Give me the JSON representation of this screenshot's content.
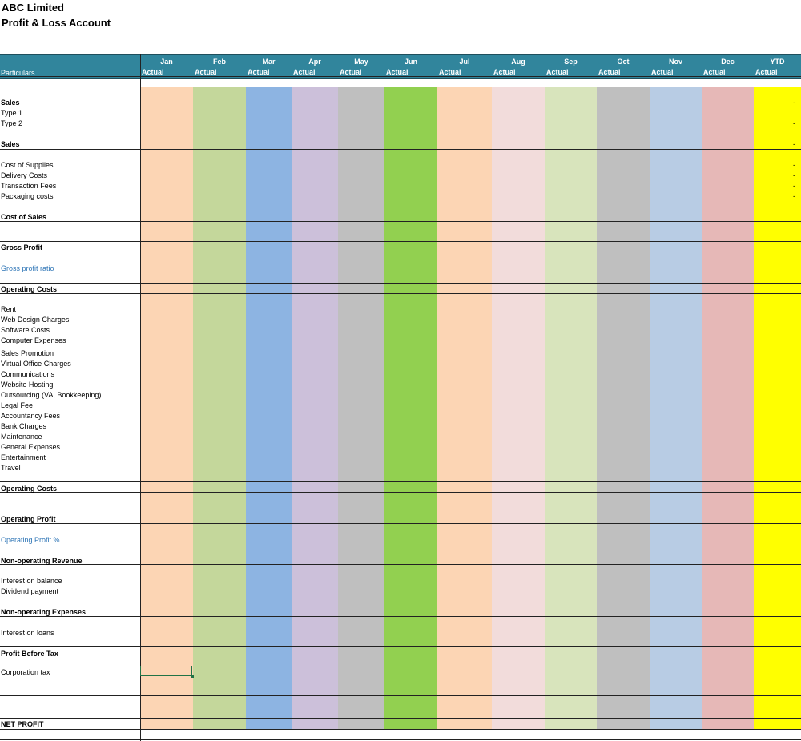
{
  "sheet": {
    "company": "ABC Limited",
    "report_title": "Profit & Loss Account"
  },
  "header": {
    "particulars": "Particulars",
    "columns": [
      {
        "month": "Jan",
        "sub": "Actual",
        "color": "#fcd5b4"
      },
      {
        "month": "Feb",
        "sub": "Actual",
        "color": "#c4d79b"
      },
      {
        "month": "Mar",
        "sub": "Actual",
        "color": "#8db4e2"
      },
      {
        "month": "Apr",
        "sub": "Actual",
        "color": "#ccc0da"
      },
      {
        "month": "May",
        "sub": "Actual",
        "color": "#bfbfbf"
      },
      {
        "month": "Jun",
        "sub": "Actual",
        "color": "#92d050"
      },
      {
        "month": "Jul",
        "sub": "Actual",
        "color": "#fcd5b4"
      },
      {
        "month": "Aug",
        "sub": "Actual",
        "color": "#f2dcdb"
      },
      {
        "month": "Sep",
        "sub": "Actual",
        "color": "#d8e4bc"
      },
      {
        "month": "Oct",
        "sub": "Actual",
        "color": "#bfbfbf"
      },
      {
        "month": "Nov",
        "sub": "Actual",
        "color": "#b8cce4"
      },
      {
        "month": "Dec",
        "sub": "Actual",
        "color": "#e6b8b7"
      },
      {
        "month": "YTD",
        "sub": "Actual",
        "color": "#ffff00"
      }
    ],
    "header_color": "#31859c"
  },
  "rows": [
    {
      "label": "Sales",
      "style": "bold",
      "ytd": "-"
    },
    {
      "label": "Type 1",
      "style": "normal",
      "ytd": ""
    },
    {
      "label": "Type 2",
      "style": "normal",
      "ytd": "-"
    },
    {
      "label": "Sales",
      "style": "bold",
      "ytd": "-"
    },
    {
      "label": "Cost of Supplies",
      "style": "normal",
      "ytd": "-"
    },
    {
      "label": "Delivery Costs",
      "style": "normal",
      "ytd": "-"
    },
    {
      "label": "Transaction Fees",
      "style": "normal",
      "ytd": "-"
    },
    {
      "label": "Packaging costs",
      "style": "normal",
      "ytd": "-"
    },
    {
      "label": "Cost of Sales",
      "style": "bold",
      "ytd": ""
    },
    {
      "label": "Gross Profit",
      "style": "bold",
      "ytd": ""
    },
    {
      "label": "Gross profit ratio",
      "style": "blue",
      "ytd": ""
    },
    {
      "label": "Operating Costs",
      "style": "bold",
      "ytd": ""
    },
    {
      "label": "Rent",
      "style": "normal",
      "ytd": ""
    },
    {
      "label": "Web Design Charges",
      "style": "normal",
      "ytd": ""
    },
    {
      "label": "Software Costs",
      "style": "normal",
      "ytd": ""
    },
    {
      "label": "Computer Expenses",
      "style": "normal",
      "ytd": ""
    },
    {
      "label": "Sales Promotion",
      "style": "normal",
      "ytd": ""
    },
    {
      "label": "Virtual Office Charges",
      "style": "normal",
      "ytd": ""
    },
    {
      "label": "Communications",
      "style": "normal",
      "ytd": ""
    },
    {
      "label": "Website Hosting",
      "style": "normal",
      "ytd": ""
    },
    {
      "label": "Outsourcing (VA, Bookkeeping)",
      "style": "normal",
      "ytd": ""
    },
    {
      "label": "Legal Fee",
      "style": "normal",
      "ytd": ""
    },
    {
      "label": "Accountancy Fees",
      "style": "normal",
      "ytd": ""
    },
    {
      "label": "Bank Charges",
      "style": "normal",
      "ytd": ""
    },
    {
      "label": "Maintenance",
      "style": "normal",
      "ytd": ""
    },
    {
      "label": "General Expenses",
      "style": "normal",
      "ytd": ""
    },
    {
      "label": "Entertainment",
      "style": "normal",
      "ytd": ""
    },
    {
      "label": "Travel",
      "style": "normal",
      "ytd": ""
    },
    {
      "label": "Operating Costs",
      "style": "bold",
      "ytd": ""
    },
    {
      "label": "Operating Profit",
      "style": "bold",
      "ytd": ""
    },
    {
      "label": "Operating Profit %",
      "style": "blue",
      "ytd": ""
    },
    {
      "label": "Non-operating Revenue",
      "style": "bold",
      "ytd": ""
    },
    {
      "label": "Interest on balance",
      "style": "normal",
      "ytd": ""
    },
    {
      "label": "Dividend payment",
      "style": "normal",
      "ytd": ""
    },
    {
      "label": "Non-operating Expenses",
      "style": "bold",
      "ytd": ""
    },
    {
      "label": "Interest on loans",
      "style": "normal",
      "ytd": ""
    },
    {
      "label": "Profit Before Tax",
      "style": "bold",
      "ytd": ""
    },
    {
      "label": "Corporation tax",
      "style": "normal",
      "ytd": ""
    },
    {
      "label": "NET PROFIT",
      "style": "bold",
      "ytd": ""
    }
  ]
}
